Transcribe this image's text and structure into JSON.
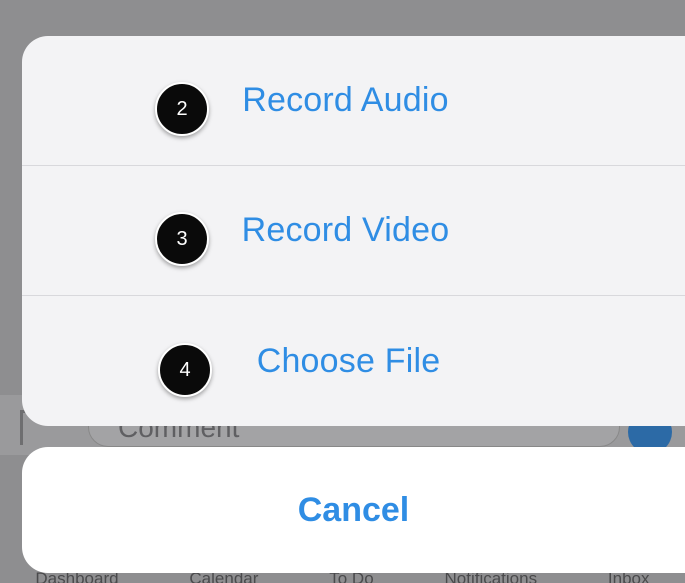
{
  "action_sheet": {
    "items": [
      {
        "step": "2",
        "label": "Record Audio"
      },
      {
        "step": "3",
        "label": "Record Video"
      },
      {
        "step": "4",
        "label": "Choose File"
      }
    ],
    "cancel_label": "Cancel"
  },
  "background": {
    "comment_placeholder": "Comment",
    "tabbar": [
      "Dashboard",
      "Calendar",
      "To Do",
      "Notifications",
      "Inbox"
    ]
  },
  "colors": {
    "accent": "#2f8de4",
    "sheet": "#f3f3f5",
    "badge": "#0a0a0a"
  }
}
